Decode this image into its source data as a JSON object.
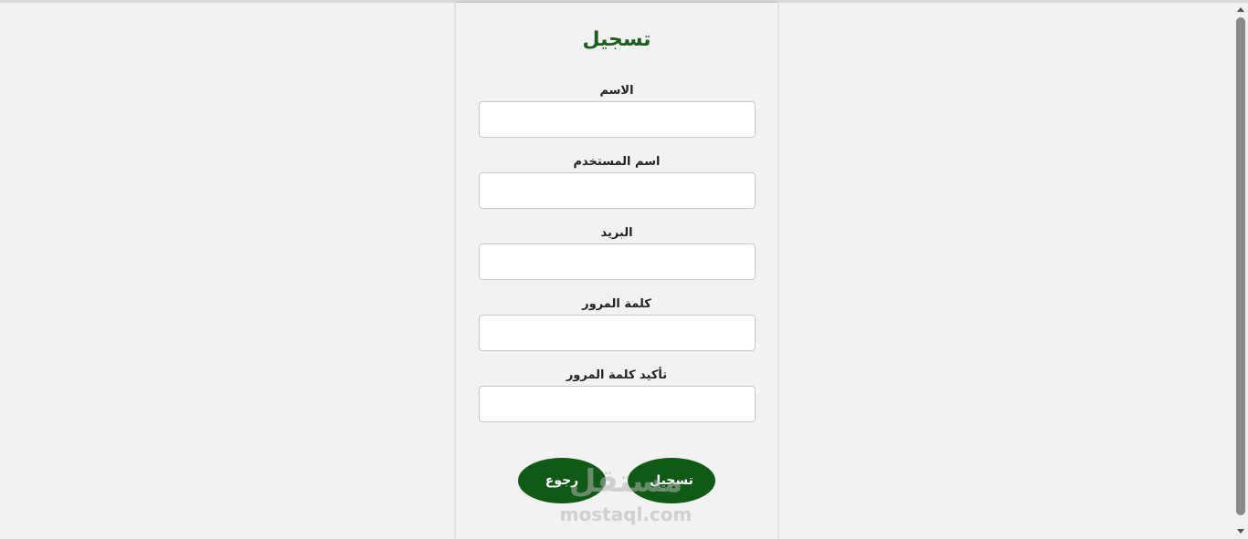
{
  "form": {
    "title": "تسجيل",
    "fields": [
      {
        "label": "الاسم",
        "value": "",
        "placeholder": ""
      },
      {
        "label": "اسم المستخدم",
        "value": "",
        "placeholder": ""
      },
      {
        "label": "البريد",
        "value": "",
        "placeholder": ""
      },
      {
        "label": "كلمة المرور",
        "value": "",
        "placeholder": ""
      },
      {
        "label": "تأكيد كلمة المرور",
        "value": "",
        "placeholder": ""
      }
    ],
    "buttons": {
      "register_label": "تسجيل",
      "back_label": "رجوع"
    }
  },
  "watermark": {
    "logo_text": "مستقل",
    "url": "mostaql.com"
  },
  "colors": {
    "accent": "#105a16",
    "title": "#1d5e1d",
    "background": "#f2f2f2"
  },
  "icons": {
    "scroll_up": "caret-up-icon",
    "scroll_down": "caret-down-icon"
  }
}
